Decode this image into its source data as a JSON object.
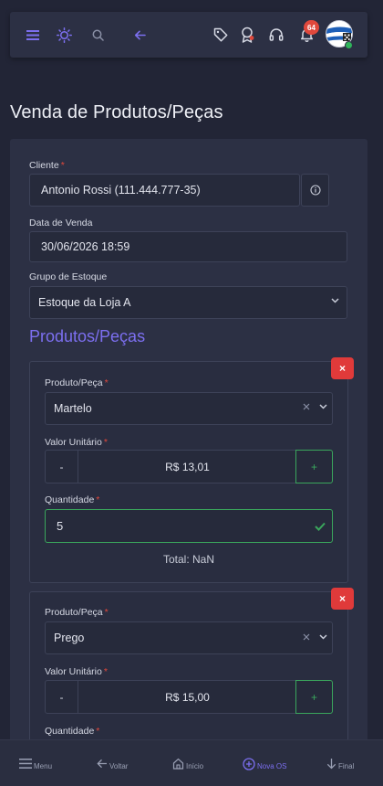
{
  "header": {
    "notification_count": "64"
  },
  "page_title": "Venda de Produtos/Peças",
  "form": {
    "cliente_label": "Cliente",
    "cliente_value": "Antonio Rossi (111.444.777-35)",
    "data_label": "Data de Venda",
    "data_value": "30/06/2026 18:59",
    "grupo_label": "Grupo de Estoque",
    "grupo_value": "Estoque da Loja A",
    "required_mark": "*"
  },
  "products_section_title": "Produtos/Peças",
  "items": [
    {
      "produto_label": "Produto/Peça",
      "produto_value": "Martelo",
      "valor_label": "Valor Unitário",
      "valor_value": "R$ 13,01",
      "quantidade_label": "Quantidade",
      "quantidade_value": "5",
      "total_text": "Total: NaN",
      "minus": "-",
      "plus": "+",
      "delete": "×"
    },
    {
      "produto_label": "Produto/Peça",
      "produto_value": "Prego",
      "valor_label": "Valor Unitário",
      "valor_value": "R$ 15,00",
      "quantidade_label": "Quantidade",
      "minus": "-",
      "plus": "+",
      "delete": "×"
    }
  ],
  "bottom_nav": {
    "menu": "Menu",
    "voltar": "Voltar",
    "inicio": "Início",
    "nova_os": "Nova OS",
    "final": "Final"
  },
  "colors": {
    "accent": "#7c6ff0",
    "danger": "#e03a3a",
    "success": "#3aa65c",
    "background": "#222536",
    "surface": "#2c3044"
  }
}
